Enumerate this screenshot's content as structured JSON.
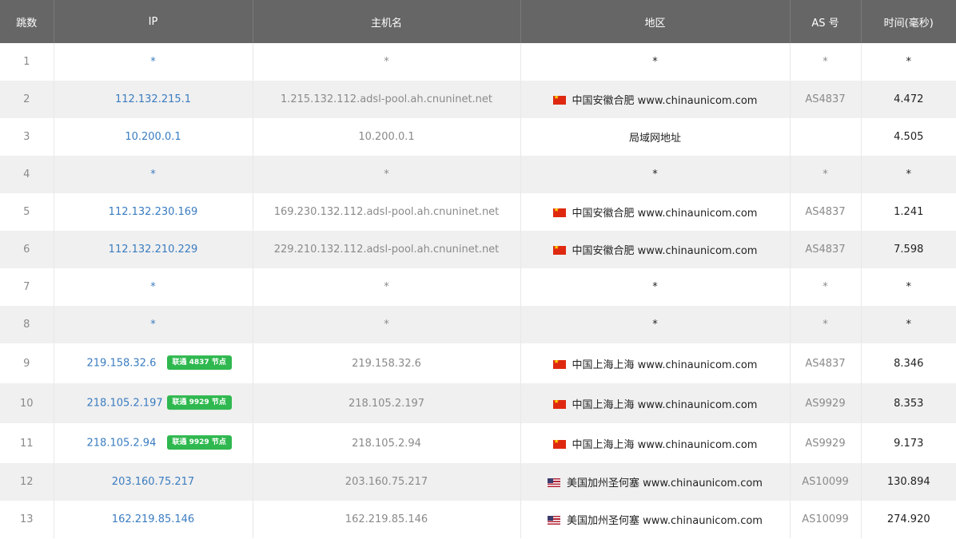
{
  "headers": [
    "跳数",
    "IP",
    "主机名",
    "地区",
    "AS 号",
    "时间(毫秒)"
  ],
  "colors": {
    "header_bg": "#666666",
    "link": "#3a7cc0",
    "badge_bg": "#2fb84f",
    "row_alt": "#f0f0f0"
  },
  "rows": [
    {
      "hop": "1",
      "ip": "*",
      "badge": "",
      "host": "*",
      "flag": "",
      "region": "*",
      "as": "*",
      "time": "*"
    },
    {
      "hop": "2",
      "ip": "112.132.215.1",
      "badge": "",
      "host": "1.215.132.112.adsl-pool.ah.cnuninet.net",
      "flag": "cn",
      "region": "中国安徽合肥 www.chinaunicom.com",
      "as": "AS4837",
      "time": "4.472"
    },
    {
      "hop": "3",
      "ip": "10.200.0.1",
      "badge": "",
      "host": "10.200.0.1",
      "flag": "",
      "region": "局域网地址",
      "as": "",
      "time": "4.505"
    },
    {
      "hop": "4",
      "ip": "*",
      "badge": "",
      "host": "*",
      "flag": "",
      "region": "*",
      "as": "*",
      "time": "*"
    },
    {
      "hop": "5",
      "ip": "112.132.230.169",
      "badge": "",
      "host": "169.230.132.112.adsl-pool.ah.cnuninet.net",
      "flag": "cn",
      "region": "中国安徽合肥 www.chinaunicom.com",
      "as": "AS4837",
      "time": "1.241"
    },
    {
      "hop": "6",
      "ip": "112.132.210.229",
      "badge": "",
      "host": "229.210.132.112.adsl-pool.ah.cnuninet.net",
      "flag": "cn",
      "region": "中国安徽合肥 www.chinaunicom.com",
      "as": "AS4837",
      "time": "7.598"
    },
    {
      "hop": "7",
      "ip": "*",
      "badge": "",
      "host": "*",
      "flag": "",
      "region": "*",
      "as": "*",
      "time": "*"
    },
    {
      "hop": "8",
      "ip": "*",
      "badge": "",
      "host": "*",
      "flag": "",
      "region": "*",
      "as": "*",
      "time": "*"
    },
    {
      "hop": "9",
      "ip": "219.158.32.6",
      "badge": "联通 4837 节点",
      "host": "219.158.32.6",
      "flag": "cn",
      "region": "中国上海上海 www.chinaunicom.com",
      "as": "AS4837",
      "time": "8.346"
    },
    {
      "hop": "10",
      "ip": "218.105.2.197",
      "badge": "联通 9929 节点",
      "host": "218.105.2.197",
      "flag": "cn",
      "region": "中国上海上海 www.chinaunicom.com",
      "as": "AS9929",
      "time": "8.353"
    },
    {
      "hop": "11",
      "ip": "218.105.2.94",
      "badge": "联通 9929 节点",
      "host": "218.105.2.94",
      "flag": "cn",
      "region": "中国上海上海 www.chinaunicom.com",
      "as": "AS9929",
      "time": "9.173"
    },
    {
      "hop": "12",
      "ip": "203.160.75.217",
      "badge": "",
      "host": "203.160.75.217",
      "flag": "us",
      "region": "美国加州圣何塞 www.chinaunicom.com",
      "as": "AS10099",
      "time": "130.894"
    },
    {
      "hop": "13",
      "ip": "162.219.85.146",
      "badge": "",
      "host": "162.219.85.146",
      "flag": "us",
      "region": "美国加州圣何塞 www.chinaunicom.com",
      "as": "AS10099",
      "time": "274.920"
    }
  ]
}
